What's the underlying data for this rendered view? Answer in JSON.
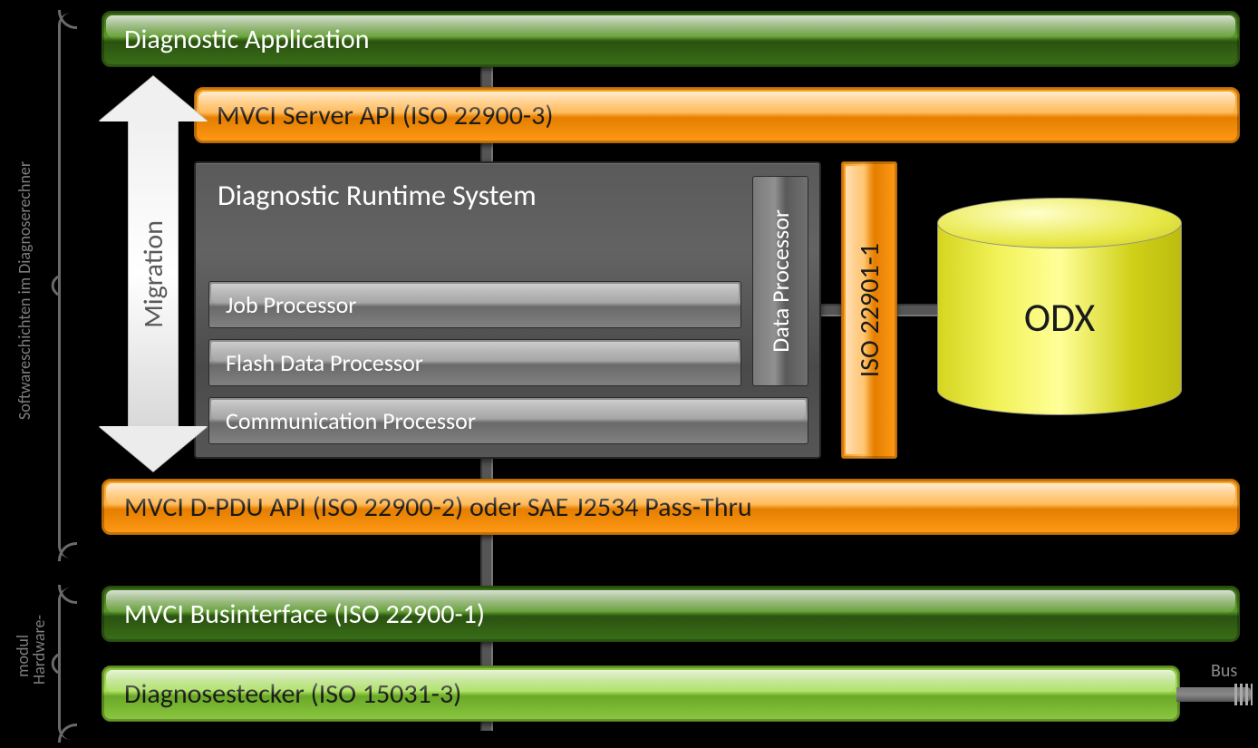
{
  "layers": {
    "application": "Diagnostic Application",
    "serverApi": "MVCI Server API (ISO 22900-3)",
    "runtime": {
      "title": "Diagnostic Runtime System",
      "dataProcessor": "Data Processor",
      "jobProcessor": "Job Processor",
      "flashDataProcessor": "Flash Data Processor",
      "communicationProcessor": "Communication Processor"
    },
    "iso22901": "ISO 22901-1",
    "odx": "ODX",
    "dpduApi": "MVCI D-PDU API (ISO 22900-2) oder SAE J2534 Pass-Thru",
    "businterface": "MVCI Businterface (ISO 22900-1)",
    "connector": "Diagnosestecker (ISO 15031-3)"
  },
  "annotations": {
    "migration": "Migration",
    "softwareSide": "Softwareschichten im Diagnoserechner",
    "hardwareSide1": "Hardware-",
    "hardwareSide2": "modul",
    "bus": "Bus"
  }
}
